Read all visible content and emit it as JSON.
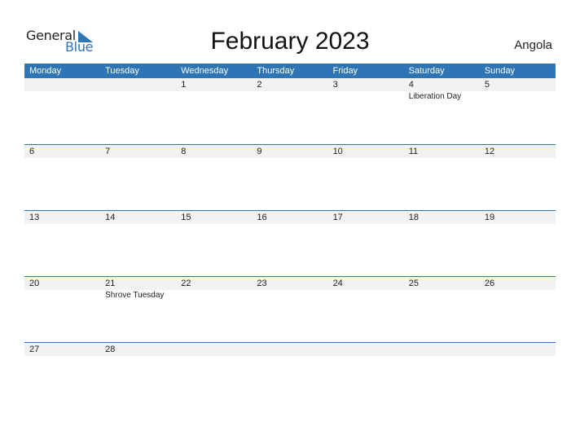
{
  "logo": {
    "word1": "General",
    "word2": "Blue"
  },
  "title": "February 2023",
  "country": "Angola",
  "colors": {
    "accent": "#2e75b6",
    "strip": "#f2f2f2"
  },
  "weekdays": [
    "Monday",
    "Tuesday",
    "Wednesday",
    "Thursday",
    "Friday",
    "Saturday",
    "Sunday"
  ],
  "weeks": [
    [
      {
        "day": ""
      },
      {
        "day": ""
      },
      {
        "day": "1"
      },
      {
        "day": "2"
      },
      {
        "day": "3"
      },
      {
        "day": "4",
        "event": "Liberation Day"
      },
      {
        "day": "5"
      }
    ],
    [
      {
        "day": "6"
      },
      {
        "day": "7"
      },
      {
        "day": "8"
      },
      {
        "day": "9"
      },
      {
        "day": "10"
      },
      {
        "day": "11"
      },
      {
        "day": "12"
      }
    ],
    [
      {
        "day": "13"
      },
      {
        "day": "14"
      },
      {
        "day": "15"
      },
      {
        "day": "16"
      },
      {
        "day": "17"
      },
      {
        "day": "18"
      },
      {
        "day": "19"
      }
    ],
    [
      {
        "day": "20"
      },
      {
        "day": "21",
        "event": "Shrove Tuesday"
      },
      {
        "day": "22"
      },
      {
        "day": "23"
      },
      {
        "day": "24"
      },
      {
        "day": "25"
      },
      {
        "day": "26"
      }
    ],
    [
      {
        "day": "27"
      },
      {
        "day": "28"
      },
      {
        "day": ""
      },
      {
        "day": ""
      },
      {
        "day": ""
      },
      {
        "day": ""
      },
      {
        "day": ""
      }
    ]
  ]
}
